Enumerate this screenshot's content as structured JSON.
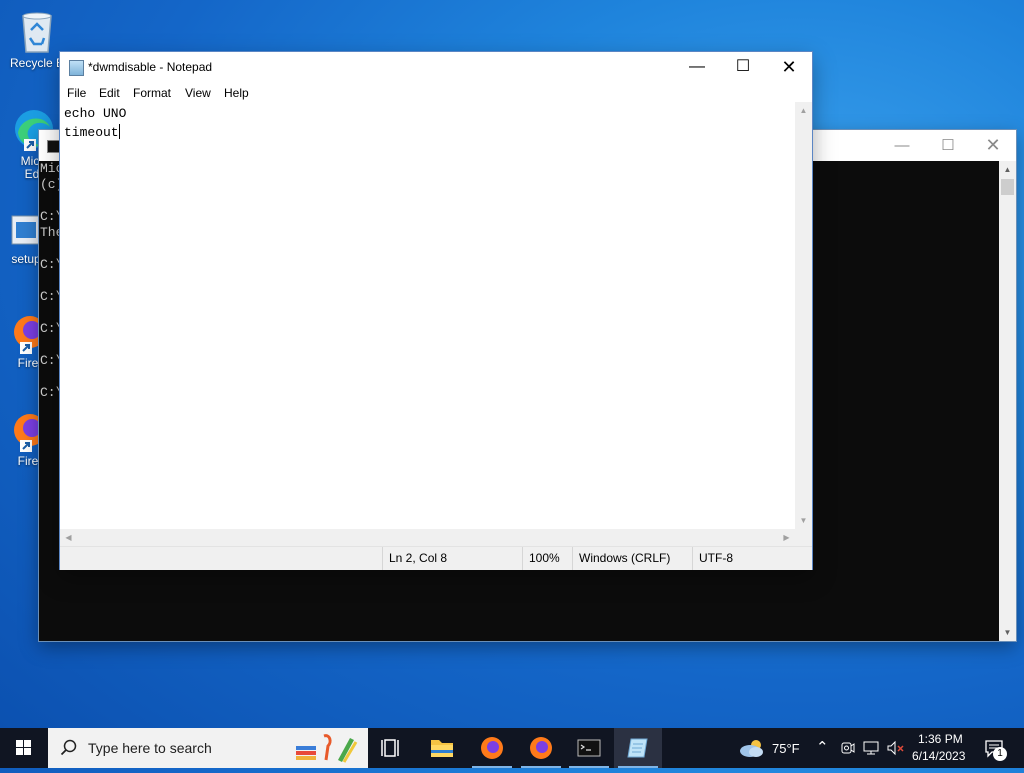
{
  "desktop": {
    "icons": [
      {
        "label": "Recycle B",
        "icon": "recycle-bin-icon"
      },
      {
        "label": "Micr\nEd",
        "icon": "edge-icon"
      },
      {
        "label": "setup",
        "icon": "setup-file-icon"
      },
      {
        "label": "Fire",
        "icon": "firefox-icon"
      },
      {
        "label": "Fire",
        "icon": "firefox-icon"
      }
    ]
  },
  "console": {
    "lines": [
      "Mic",
      "(c)",
      "",
      "C:\\",
      "The",
      "",
      "C:\\",
      "",
      "C:\\",
      "",
      "C:\\",
      "",
      "C:\\",
      "",
      "C:\\"
    ]
  },
  "notepad": {
    "title": "*dwmdisable - Notepad",
    "menu": [
      "File",
      "Edit",
      "Format",
      "View",
      "Help"
    ],
    "content": {
      "line1": "echo UNO",
      "line2": "timeout"
    },
    "status": {
      "position": "Ln 2, Col 8",
      "zoom": "100%",
      "line_endings": "Windows (CRLF)",
      "encoding": "UTF-8"
    }
  },
  "taskbar": {
    "search_placeholder": "Type here to search",
    "apps": [
      {
        "name": "task-view",
        "icon": "task-view-icon"
      },
      {
        "name": "file-explorer",
        "icon": "folder-icon"
      },
      {
        "name": "firefox-1",
        "icon": "firefox-icon"
      },
      {
        "name": "firefox-2",
        "icon": "firefox-icon"
      },
      {
        "name": "command-prompt",
        "icon": "terminal-icon"
      },
      {
        "name": "notepad",
        "icon": "notepad-icon"
      }
    ],
    "weather": "75°F",
    "time": "1:36 PM",
    "date": "6/14/2023",
    "notifications": "1"
  }
}
